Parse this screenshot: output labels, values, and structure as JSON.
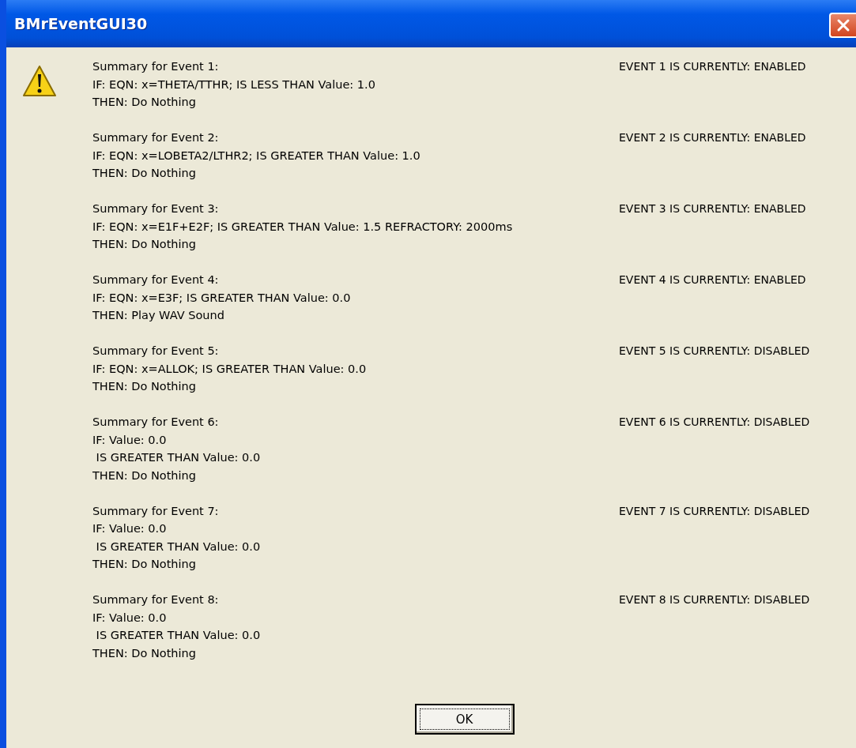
{
  "window": {
    "title": "BMrEventGUI30"
  },
  "events": [
    {
      "lines": [
        "Summary for Event 1:",
        "IF: EQN: x=THETA/TTHR; IS LESS THAN Value: 1.0",
        "THEN: Do Nothing"
      ],
      "status": "EVENT 1 IS CURRENTLY: ENABLED"
    },
    {
      "lines": [
        "Summary for Event 2:",
        "IF: EQN: x=LOBETA2/LTHR2; IS GREATER THAN Value: 1.0",
        "THEN: Do Nothing"
      ],
      "status": "EVENT 2 IS CURRENTLY: ENABLED"
    },
    {
      "lines": [
        "Summary for Event 3:",
        "IF: EQN: x=E1F+E2F; IS GREATER THAN Value: 1.5 REFRACTORY: 2000ms",
        "THEN: Do Nothing"
      ],
      "status": "EVENT 3 IS CURRENTLY: ENABLED"
    },
    {
      "lines": [
        "Summary for Event 4:",
        "IF: EQN: x=E3F; IS GREATER THAN Value: 0.0",
        "THEN: Play WAV Sound"
      ],
      "status": "EVENT 4 IS CURRENTLY: ENABLED"
    },
    {
      "lines": [
        "Summary for Event 5:",
        "IF: EQN: x=ALLOK; IS GREATER THAN Value: 0.0",
        "THEN: Do Nothing"
      ],
      "status": "EVENT 5 IS CURRENTLY: DISABLED"
    },
    {
      "lines": [
        "Summary for Event 6:",
        "IF: Value: 0.0",
        " IS GREATER THAN Value: 0.0",
        "THEN: Do Nothing"
      ],
      "status": "EVENT 6 IS CURRENTLY: DISABLED"
    },
    {
      "lines": [
        "Summary for Event 7:",
        "IF: Value: 0.0",
        " IS GREATER THAN Value: 0.0",
        "THEN: Do Nothing"
      ],
      "status": "EVENT 7 IS CURRENTLY: DISABLED"
    },
    {
      "lines": [
        "Summary for Event 8:",
        "IF: Value: 0.0",
        " IS GREATER THAN Value: 0.0",
        "THEN: Do Nothing"
      ],
      "status": "EVENT 8 IS CURRENTLY: DISABLED"
    }
  ],
  "buttons": [
    "OK"
  ]
}
